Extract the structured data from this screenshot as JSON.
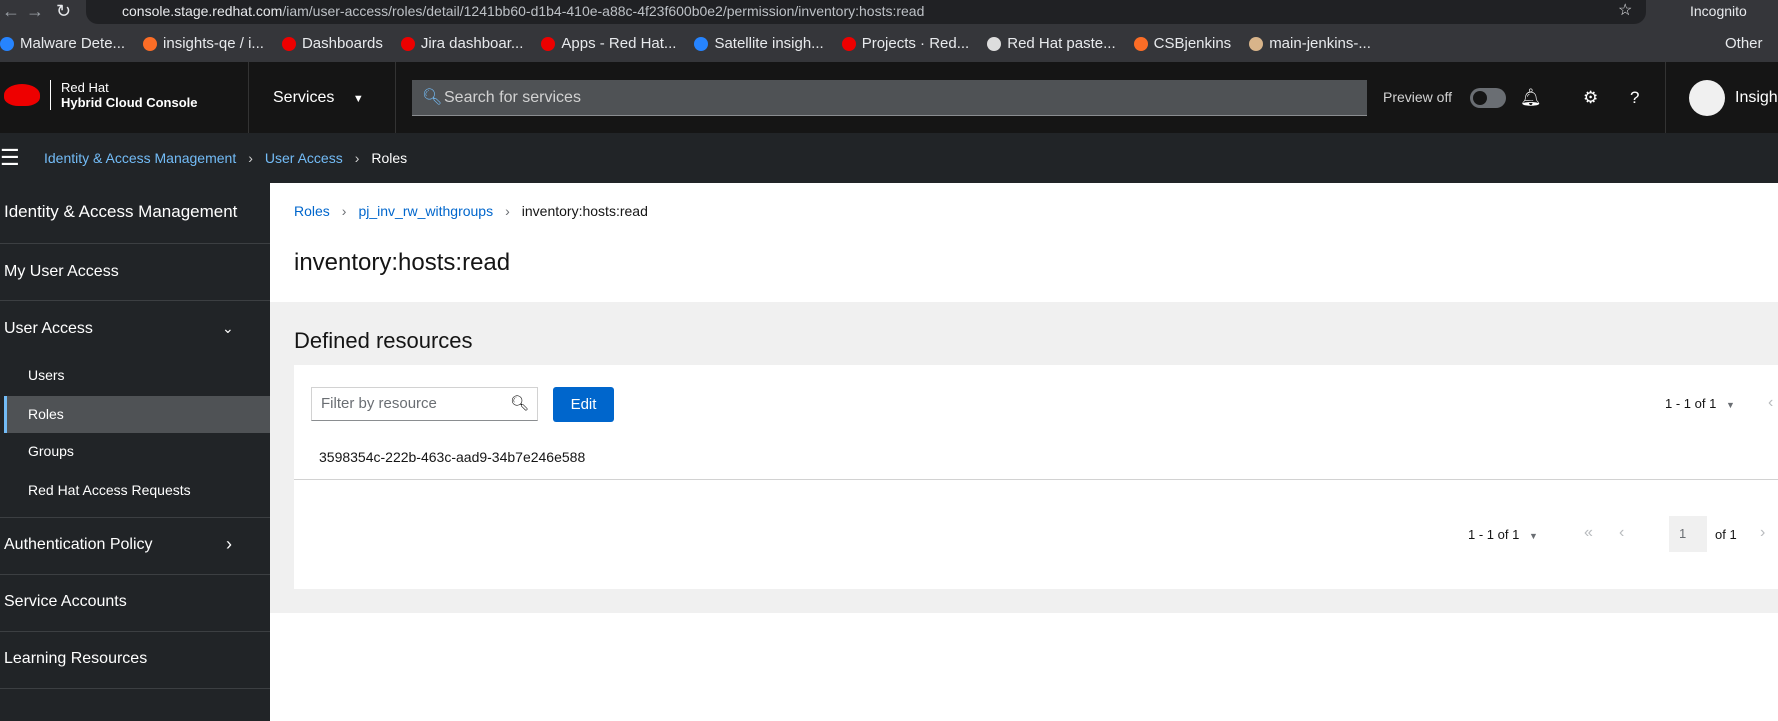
{
  "browser": {
    "url_host": "console.stage.redhat.com",
    "url_path": "/iam/user-access/roles/detail/1241bb60-d1b4-410e-a88c-4f23f600b0e2/permission/inventory:hosts:read",
    "profile": "Incognito",
    "bookmarks": [
      {
        "label": "Malware Dete...",
        "color": "#2684ff"
      },
      {
        "label": "insights-qe / i...",
        "color": "#fc6d26"
      },
      {
        "label": "Dashboards",
        "color": "#e00"
      },
      {
        "label": "Jira dashboar...",
        "color": "#e00"
      },
      {
        "label": "Apps - Red Hat...",
        "color": "#e00"
      },
      {
        "label": "Satellite insigh...",
        "color": "#2684ff"
      },
      {
        "label": "Projects · Red...",
        "color": "#e00"
      },
      {
        "label": "Red Hat paste...",
        "color": "#ddd"
      },
      {
        "label": "CSBjenkins",
        "color": "#fc6d26"
      },
      {
        "label": "main-jenkins-...",
        "color": "#d8b48a"
      }
    ],
    "other": "Other"
  },
  "masthead": {
    "logo_line1": "Red Hat",
    "logo_line2": "Hybrid Cloud Console",
    "services": "Services",
    "search_placeholder": "Search for services",
    "preview": "Preview off",
    "user": "Insights"
  },
  "nav_breadcrumb": [
    "Identity & Access Management",
    "User Access",
    "Roles"
  ],
  "sidebar": {
    "title": "Identity & Access Management",
    "my_user_access": "My User Access",
    "user_access": "User Access",
    "sub": [
      "Users",
      "Roles",
      "Groups",
      "Red Hat Access Requests"
    ],
    "auth_policy": "Authentication Policy",
    "service_accounts": "Service Accounts",
    "learning": "Learning Resources"
  },
  "page": {
    "breadcrumb": [
      "Roles",
      "pj_inv_rw_withgroups",
      "inventory:hosts:read"
    ],
    "title": "inventory:hosts:read",
    "section": "Defined resources",
    "filter_placeholder": "Filter by resource",
    "edit": "Edit",
    "pagination_top": "1 - 1 of 1",
    "rows": [
      "3598354c-222b-463c-aad9-34b7e246e588"
    ],
    "pagination_bottom": "1 - 1 of 1",
    "page_input": "1",
    "of_pages": "of 1"
  }
}
